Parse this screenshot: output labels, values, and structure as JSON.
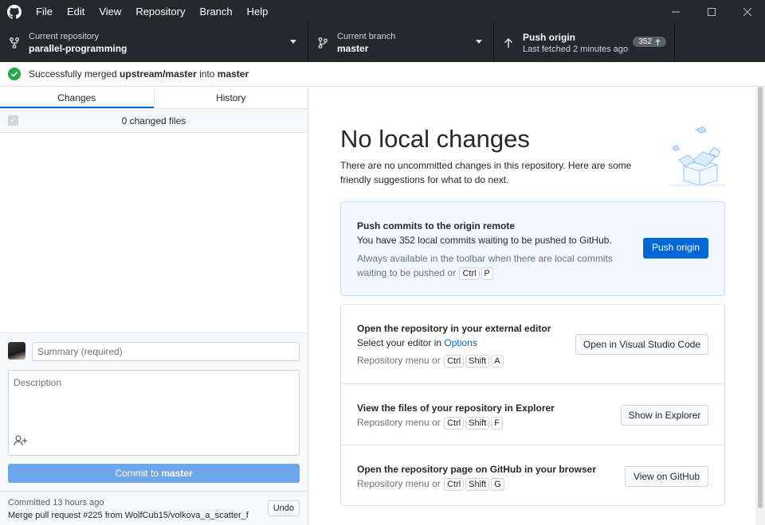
{
  "menu": [
    "File",
    "Edit",
    "View",
    "Repository",
    "Branch",
    "Help"
  ],
  "toolbar": {
    "repo_label": "Current repository",
    "repo_value": "parallel-programming",
    "branch_label": "Current branch",
    "branch_value": "master",
    "push_title": "Push origin",
    "push_sub": "Last fetched 2 minutes ago",
    "push_count": "352"
  },
  "banner": {
    "prefix": "Successfully merged ",
    "source": "upstream/master",
    "mid": " into ",
    "target": "master"
  },
  "left": {
    "tab_changes": "Changes",
    "tab_history": "History",
    "changed_files": "0 changed files",
    "summary_placeholder": "Summary (required)",
    "description_placeholder": "Description",
    "commit_prefix": "Commit to ",
    "commit_branch": "master",
    "last_commit_time": "Committed 13 hours ago",
    "last_commit_msg": "Merge pull request #225 from WolfCub15/volkova_a_scatter_f",
    "undo": "Undo"
  },
  "right": {
    "title": "No local changes",
    "subtitle": "There are no uncommitted changes in this repository. Here are some friendly suggestions for what to do next.",
    "push_card": {
      "heading": "Push commits to the origin remote",
      "line": "You have 352 local commits waiting to be pushed to GitHub.",
      "note_1": "Always available in the toolbar when there are local commits",
      "note_2": "waiting to be pushed or",
      "keys": [
        "Ctrl",
        "P"
      ],
      "button": "Push origin"
    },
    "editor": {
      "heading": "Open the repository in your external editor",
      "line_prefix": "Select your editor in ",
      "line_link": "Options",
      "menu_text": "Repository menu or",
      "keys": [
        "Ctrl",
        "Shift",
        "A"
      ],
      "button": "Open in Visual Studio Code"
    },
    "explorer": {
      "heading": "View the files of your repository in Explorer",
      "menu_text": "Repository menu or",
      "keys": [
        "Ctrl",
        "Shift",
        "F"
      ],
      "button": "Show in Explorer"
    },
    "github": {
      "heading": "Open the repository page on GitHub in your browser",
      "menu_text": "Repository menu or",
      "keys": [
        "Ctrl",
        "Shift",
        "G"
      ],
      "button": "View on GitHub"
    }
  },
  "colors": {
    "titlebar": "#24292e",
    "accent": "#0366d6",
    "success": "#28a745",
    "commit_button_disabled": "#6ea6ea"
  }
}
